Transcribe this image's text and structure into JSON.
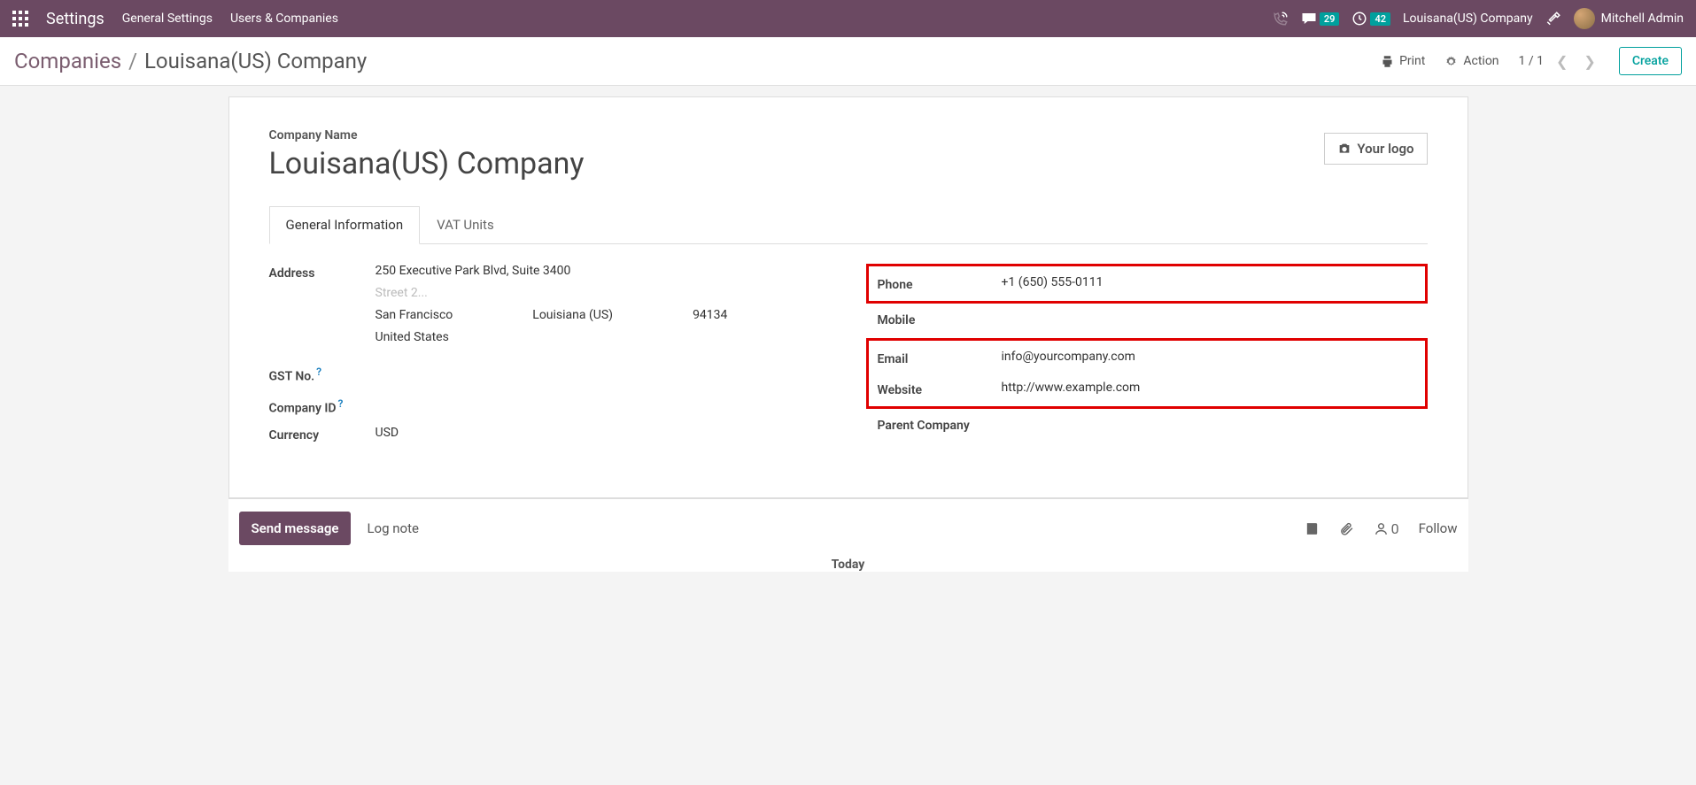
{
  "topnav": {
    "title": "Settings",
    "links": [
      "General Settings",
      "Users & Companies"
    ],
    "msg_badge": "29",
    "clock_badge": "42",
    "company": "Louisana(US) Company",
    "user": "Mitchell Admin"
  },
  "actionbar": {
    "breadcrumb_root": "Companies",
    "breadcrumb_current": "Louisana(US) Company",
    "print": "Print",
    "action": "Action",
    "pager": "1 / 1",
    "create": "Create"
  },
  "form": {
    "company_label": "Company Name",
    "company_name": "Louisana(US) Company",
    "your_logo": "Your logo",
    "tabs": [
      "General Information",
      "VAT Units"
    ],
    "left": {
      "address_label": "Address",
      "street1": "250 Executive Park Blvd, Suite 3400",
      "street2_placeholder": "Street 2...",
      "city": "San Francisco",
      "state": "Louisiana (US)",
      "zip": "94134",
      "country": "United States",
      "gst_label": "GST No.",
      "company_id_label": "Company ID",
      "currency_label": "Currency",
      "currency": "USD"
    },
    "right": {
      "phone_label": "Phone",
      "phone": "+1 (650) 555-0111",
      "mobile_label": "Mobile",
      "email_label": "Email",
      "email": "info@yourcompany.com",
      "website_label": "Website",
      "website": "http://www.example.com",
      "parent_label": "Parent Company"
    }
  },
  "chatter": {
    "send": "Send message",
    "log": "Log note",
    "followers": "0",
    "follow": "Follow",
    "today": "Today"
  }
}
